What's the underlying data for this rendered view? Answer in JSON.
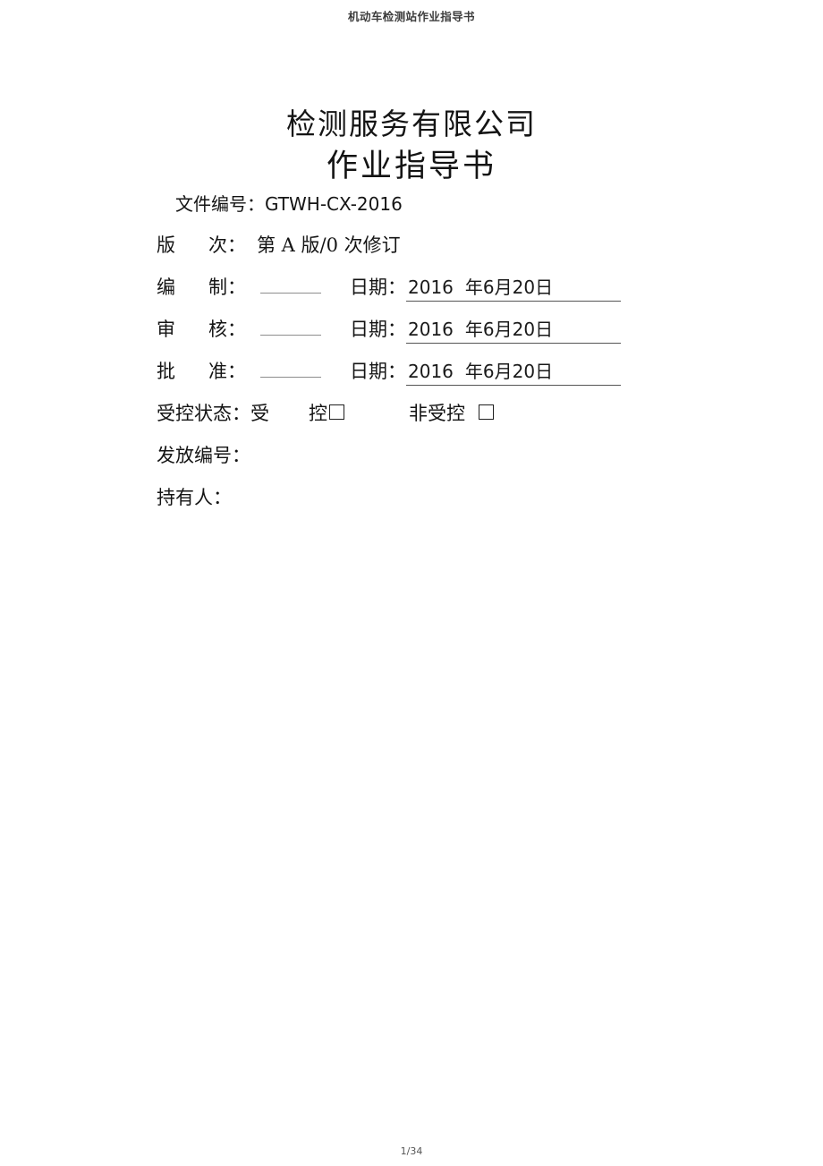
{
  "header": {
    "running_title": "机动车检测站作业指导书"
  },
  "title": {
    "company": "检测服务有限公司",
    "document": "作业指导书"
  },
  "meta": {
    "doc_number": {
      "label": "文件编号：",
      "value": "GTWH-CX-2016"
    },
    "version": {
      "label_char1": "版",
      "label_char2": "次：",
      "value": "第 A 版/0 次修订"
    },
    "date_label": "日期：",
    "date": {
      "year": "2016",
      "year_unit": "年",
      "month": "6",
      "month_unit": "月",
      "day": "20",
      "day_unit": "日"
    },
    "signature_rows": [
      {
        "label_char1": "编",
        "label_char2": "制："
      },
      {
        "label_char1": "审",
        "label_char2": "核："
      },
      {
        "label_char1": "批",
        "label_char2": "准："
      }
    ],
    "control_status": {
      "label": "受控状态：",
      "option_controlled_part1": "受",
      "option_controlled_part2": "控",
      "option_uncontrolled": "非受控",
      "controlled_checked": false,
      "uncontrolled_checked": false
    },
    "issue_number": {
      "label": "发放编号："
    },
    "holder": {
      "label": "持有人："
    }
  },
  "footer": {
    "page_indicator": "1/34"
  }
}
